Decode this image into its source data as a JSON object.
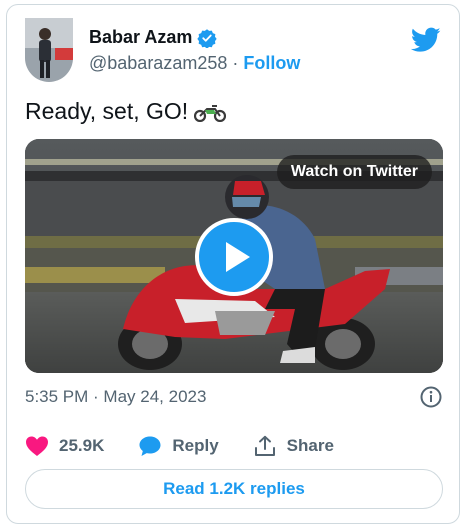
{
  "author": {
    "name": "Babar Azam",
    "handle": "@babarazam258",
    "separator": "·",
    "follow_label": "Follow"
  },
  "tweet": {
    "text": "Ready, set, GO!",
    "emoji": "motorcycle-emoji"
  },
  "media": {
    "watch_label": "Watch on Twitter"
  },
  "meta": {
    "timestamp": "5:35 PM · May 24, 2023"
  },
  "actions": {
    "likes": "25.9K",
    "reply_label": "Reply",
    "share_label": "Share"
  },
  "replies_button": "Read 1.2K replies",
  "colors": {
    "accent": "#1d9bf0",
    "like": "#f91880",
    "secondary_text": "#536471"
  },
  "icons": [
    "twitter-bird-icon",
    "verified-badge-icon",
    "play-icon",
    "info-icon",
    "heart-icon",
    "reply-bubble-icon",
    "share-icon"
  ]
}
